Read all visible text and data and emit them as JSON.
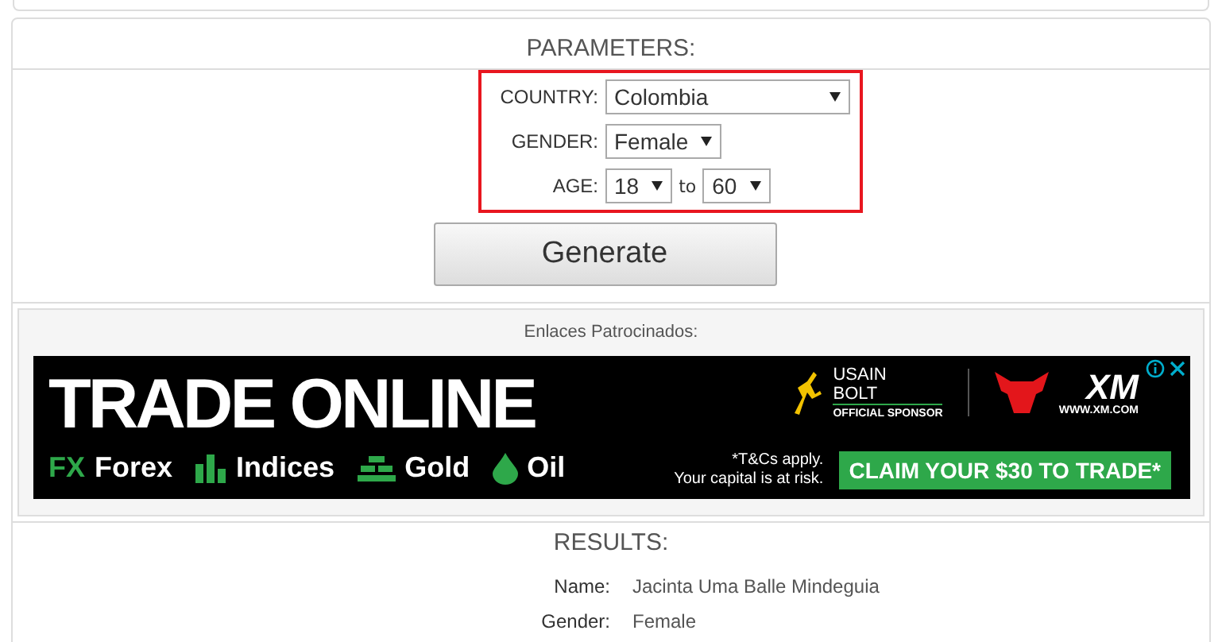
{
  "parameters": {
    "title": "PARAMETERS:",
    "country": {
      "label": "COUNTRY:",
      "value": "Colombia"
    },
    "gender": {
      "label": "GENDER:",
      "value": "Female"
    },
    "age": {
      "label": "AGE:",
      "from": "18",
      "separator": "to",
      "to": "60"
    },
    "button": "Generate"
  },
  "sponsored": {
    "title": "Enlaces Patrocinados:",
    "ad": {
      "headline": "TRADE ONLINE",
      "markets": [
        {
          "kind": "fx",
          "icon": "FX",
          "label": "Forex"
        },
        {
          "kind": "bars",
          "label": "Indices"
        },
        {
          "kind": "bricks",
          "label": "Gold"
        },
        {
          "kind": "drop",
          "label": "Oil"
        }
      ],
      "sponsor_name": "USAIN BOLT",
      "sponsor_note": "OFFICIAL SPONSOR",
      "brand": "XM",
      "brand_url": "WWW.XM.COM",
      "terms": "*T&Cs apply.",
      "risk": "Your capital is at risk.",
      "cta": "CLAIM YOUR $30 TO TRADE*"
    }
  },
  "results": {
    "title": "RESULTS:",
    "rows": [
      {
        "label": "Name:",
        "value": "Jacinta Uma Balle Mindeguia"
      },
      {
        "label": "Gender:",
        "value": "Female"
      }
    ]
  }
}
